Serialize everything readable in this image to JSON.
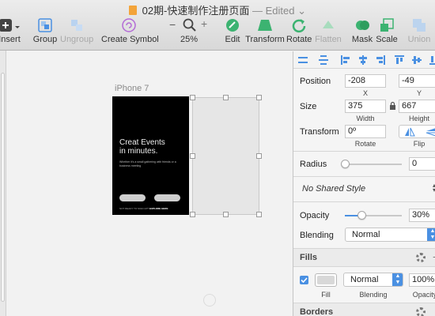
{
  "window": {
    "title": "02期-快速制作注册页面",
    "status": "— Edited",
    "status_chevron": "⌄"
  },
  "toolbar": {
    "insert": {
      "label": "Insert",
      "icon": "plus-icon"
    },
    "group": {
      "label": "Group",
      "icon": "group-icon"
    },
    "ungroup": {
      "label": "Ungroup",
      "icon": "ungroup-icon"
    },
    "create_symbol": {
      "label": "Create Symbol",
      "icon": "symbol-icon"
    },
    "zoom": {
      "label": "25%",
      "minus": "−",
      "plus": "+",
      "icon": "magnifier-icon"
    },
    "edit": {
      "label": "Edit",
      "icon": "edit-icon"
    },
    "transform": {
      "label": "Transform",
      "icon": "transform-icon"
    },
    "rotate": {
      "label": "Rotate",
      "icon": "rotate-icon"
    },
    "flatten": {
      "label": "Flatten",
      "icon": "flatten-icon"
    },
    "mask": {
      "label": "Mask",
      "icon": "mask-icon"
    },
    "scale": {
      "label": "Scale",
      "icon": "scale-icon"
    },
    "union": {
      "label": "Union",
      "icon": "union-icon"
    }
  },
  "canvas": {
    "artboard_name": "iPhone 7",
    "artboard": {
      "headline_line1": "Creat Events",
      "headline_line2": "in minutes.",
      "subtext": "Whether it's a small gathering with friends or a business meeting",
      "footer_prefix": "NOT READY TO SIGN UP?",
      "footer_link": "EXPLORE HERE"
    }
  },
  "inspector": {
    "position": {
      "label": "Position",
      "x": "-208",
      "y": "-49",
      "x_label": "X",
      "y_label": "Y"
    },
    "size": {
      "label": "Size",
      "width": "375",
      "height": "667",
      "width_label": "Width",
      "height_label": "Height"
    },
    "transform": {
      "label": "Transform",
      "rotate": "0º",
      "rotate_label": "Rotate",
      "flip_label": "Flip"
    },
    "radius": {
      "label": "Radius",
      "value": "0",
      "level": 0
    },
    "shared_style": "No Shared Style",
    "opacity": {
      "label": "Opacity",
      "value": "30%",
      "level": 0.3
    },
    "blending": {
      "label": "Blending",
      "value": "Normal"
    },
    "fills": {
      "header": "Fills",
      "enabled": true,
      "fill_color": "#d8d8d8",
      "fill_label": "Fill",
      "blend_value": "Normal",
      "blend_label": "Blending",
      "opacity_value": "100%",
      "opacity_label": "Opacity"
    },
    "borders": {
      "header": "Borders"
    }
  },
  "colors": {
    "accent": "#4a90e2",
    "artboard_bg": "#000000",
    "toolbar_icon_green": "#3cb371"
  }
}
